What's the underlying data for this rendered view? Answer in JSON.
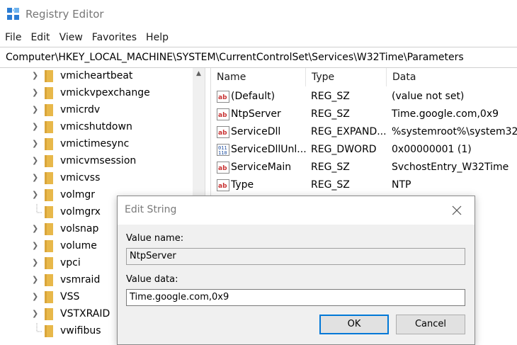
{
  "window": {
    "title": "Registry Editor",
    "icon": "registry-editor-icon"
  },
  "menu": [
    "File",
    "Edit",
    "View",
    "Favorites",
    "Help"
  ],
  "address": {
    "path": "Computer\\HKEY_LOCAL_MACHINE\\SYSTEM\\CurrentControlSet\\Services\\W32Time\\Parameters"
  },
  "tree": {
    "items": [
      {
        "label": "vmicheartbeat",
        "expandable": true
      },
      {
        "label": "vmickvpexchange",
        "expandable": true
      },
      {
        "label": "vmicrdv",
        "expandable": true
      },
      {
        "label": "vmicshutdown",
        "expandable": true
      },
      {
        "label": "vmictimesync",
        "expandable": true
      },
      {
        "label": "vmicvmsession",
        "expandable": true
      },
      {
        "label": "vmicvss",
        "expandable": true
      },
      {
        "label": "volmgr",
        "expandable": true
      },
      {
        "label": "volmgrx",
        "expandable": false
      },
      {
        "label": "volsnap",
        "expandable": true
      },
      {
        "label": "volume",
        "expandable": true
      },
      {
        "label": "vpci",
        "expandable": true
      },
      {
        "label": "vsmraid",
        "expandable": true
      },
      {
        "label": "VSS",
        "expandable": true
      },
      {
        "label": "VSTXRAID",
        "expandable": true
      },
      {
        "label": "vwifibus",
        "expandable": false
      }
    ]
  },
  "list": {
    "columns": [
      "Name",
      "Type",
      "Data"
    ],
    "rows": [
      {
        "icon": "string-value-icon",
        "name": "(Default)",
        "type": "REG_SZ",
        "data": "(value not set)"
      },
      {
        "icon": "string-value-icon",
        "name": "NtpServer",
        "type": "REG_SZ",
        "data": "Time.google.com,0x9"
      },
      {
        "icon": "string-value-icon",
        "name": "ServiceDll",
        "type": "REG_EXPAND...",
        "data": "%systemroot%\\system32"
      },
      {
        "icon": "binary-value-icon",
        "name": "ServiceDllUnl...",
        "type": "REG_DWORD",
        "data": "0x00000001 (1)"
      },
      {
        "icon": "string-value-icon",
        "name": "ServiceMain",
        "type": "REG_SZ",
        "data": "SvchostEntry_W32Time"
      },
      {
        "icon": "string-value-icon",
        "name": "Type",
        "type": "REG_SZ",
        "data": "NTP"
      }
    ]
  },
  "dialog": {
    "title": "Edit String",
    "value_name_label": "Value name:",
    "value_name": "NtpServer",
    "value_data_label": "Value data:",
    "value_data": "Time.google.com,0x9",
    "ok_label": "OK",
    "cancel_label": "Cancel"
  },
  "colors": {
    "folder": "#e8b84a",
    "accent": "#0078d7",
    "string_icon_red": "#c83232",
    "binary_icon_blue": "#1f4fa0"
  }
}
